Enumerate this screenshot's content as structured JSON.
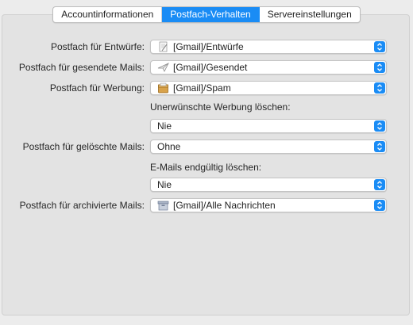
{
  "tabs": [
    {
      "label": "Accountinformationen",
      "active": false
    },
    {
      "label": "Postfach-Verhalten",
      "active": true
    },
    {
      "label": "Servereinstellungen",
      "active": false
    }
  ],
  "colors": {
    "accent": "#1a8cf5",
    "window_background": "#ececec",
    "panel_background": "#e3e3e3"
  },
  "mailbox_behavior": {
    "drafts": {
      "label": "Postfach für Entwürfe:",
      "value": "[Gmail]/Entwürfe",
      "icon": "drafts-folder-icon"
    },
    "sent": {
      "label": "Postfach für gesendete Mails:",
      "value": "[Gmail]/Gesendet",
      "icon": "sent-folder-icon"
    },
    "junk": {
      "label": "Postfach für Werbung:",
      "value": "[Gmail]/Spam",
      "icon": "junk-folder-icon"
    },
    "junk_delete": {
      "label": "Unerwünschte Werbung löschen:",
      "value": "Nie"
    },
    "trash": {
      "label": "Postfach für gelöschte Mails:",
      "value": "Ohne"
    },
    "trash_delete": {
      "label": "E-Mails endgültig löschen:",
      "value": "Nie"
    },
    "archive": {
      "label": "Postfach für archivierte Mails:",
      "value": "[Gmail]/Alle Nachrichten",
      "icon": "archive-box-icon"
    }
  }
}
